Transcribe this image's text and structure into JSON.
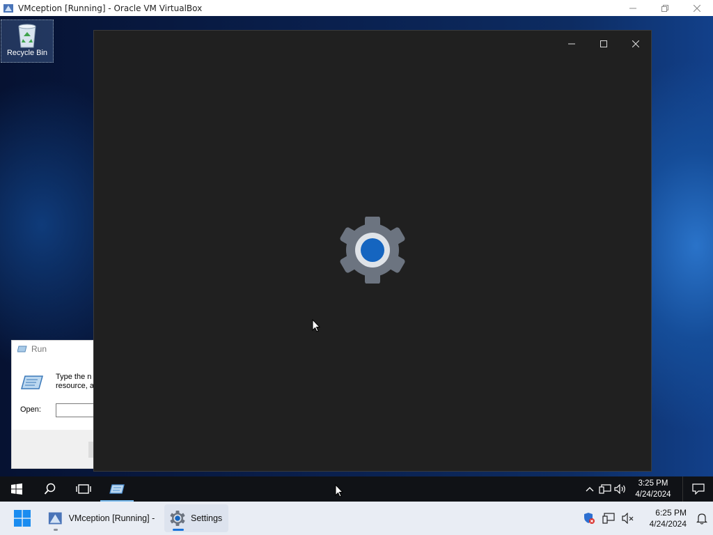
{
  "host_window": {
    "title": "VMception [Running] - Oracle VM VirtualBox"
  },
  "desktop": {
    "recycle_bin_label": "Recycle Bin"
  },
  "run_dialog": {
    "title": "Run",
    "description_line1": "Type the n",
    "description_line2": "resource, a",
    "open_label": "Open:",
    "open_value": ""
  },
  "settings_window": {
    "splash_icon": "settings-gear-icon",
    "accent": "#1565c0"
  },
  "guest_taskbar": {
    "clock_time": "3:25 PM",
    "clock_date": "4/24/2024"
  },
  "host_taskbar": {
    "vbox_label": "VMception [Running] - (",
    "settings_label": "Settings",
    "clock_time": "6:25 PM",
    "clock_date": "4/24/2024"
  },
  "colors": {
    "host_taskbar_bg": "#e9edf4",
    "guest_taskbar_bg": "#101216",
    "settings_bg": "#202020"
  }
}
